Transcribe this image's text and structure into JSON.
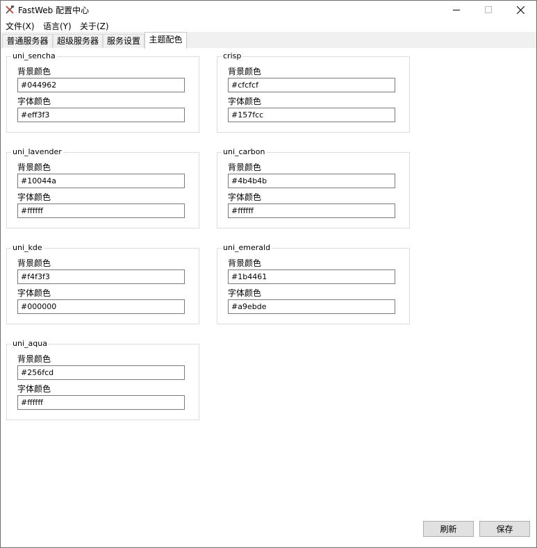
{
  "window": {
    "title": "FastWeb 配置中心",
    "icon": "crossed-tools-icon",
    "controls": [
      "minimize-icon",
      "maximize-icon",
      "close-icon"
    ]
  },
  "menu": [
    "文件(X)",
    "语言(Y)",
    "关于(Z)"
  ],
  "tabs": [
    {
      "label": "普通服务器",
      "active": false
    },
    {
      "label": "超级服务器",
      "active": false
    },
    {
      "label": "服务设置",
      "active": false
    },
    {
      "label": "主题配色",
      "active": true
    }
  ],
  "themes": [
    {
      "name": "uni_sencha",
      "bg_label": "背景颜色",
      "bg": "#044962",
      "fg_label": "字体颜色",
      "fg": "#eff3f3"
    },
    {
      "name": "crisp",
      "bg_label": "背景颜色",
      "bg": "#cfcfcf",
      "fg_label": "字体颜色",
      "fg": "#157fcc"
    },
    {
      "name": "uni_lavender",
      "bg_label": "背景颜色",
      "bg": "#10044a",
      "fg_label": "字体颜色",
      "fg": "#ffffff"
    },
    {
      "name": "uni_carbon",
      "bg_label": "背景颜色",
      "bg": "#4b4b4b",
      "fg_label": "字体颜色",
      "fg": "#ffffff"
    },
    {
      "name": "uni_kde",
      "bg_label": "背景颜色",
      "bg": "#f4f3f3",
      "fg_label": "字体颜色",
      "fg": "#000000"
    },
    {
      "name": "uni_emerald",
      "bg_label": "背景颜色",
      "bg": "#1b4461",
      "fg_label": "字体颜色",
      "fg": "#a9ebde"
    },
    {
      "name": "uni_aqua",
      "bg_label": "背景颜色",
      "bg": "#256fcd",
      "fg_label": "字体颜色",
      "fg": "#ffffff"
    }
  ],
  "buttons": {
    "refresh": "刷新",
    "save": "保存"
  }
}
